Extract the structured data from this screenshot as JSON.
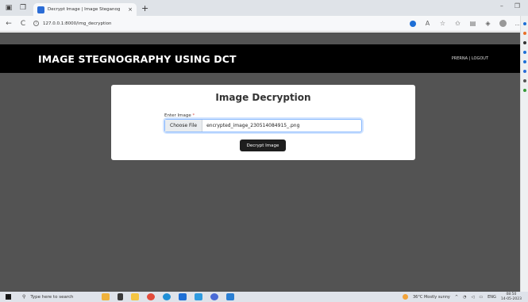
{
  "browser": {
    "tab_title": "Decrypt Image | Image Steganog",
    "tab_close": "×",
    "new_tab": "+",
    "url": "127.0.0.1:8000/img_decryption",
    "back": "←",
    "refresh": "C"
  },
  "navbar": {
    "brand": "IMAGE STEGNOGRAPHY USING DCT",
    "user": "PRERNA | LOGOUT"
  },
  "card": {
    "title": "Image Decryption",
    "label": "Enter Image",
    "required_mark": "*",
    "choose_file_label": "Choose File",
    "file_name": "encrypted_image_230514084915_.png",
    "submit_label": "Decrypt Image"
  },
  "taskbar": {
    "search_placeholder": "Type here to search",
    "weather": "36°C Mostly sunny",
    "lang": "ENG",
    "time": "08:50",
    "date": "14-05-2023"
  },
  "colors": {
    "page_bg": "#535353",
    "navbar_bg": "#000000",
    "card_bg": "#ffffff",
    "button_bg": "#1e1e1e",
    "required": "#d9534f"
  }
}
